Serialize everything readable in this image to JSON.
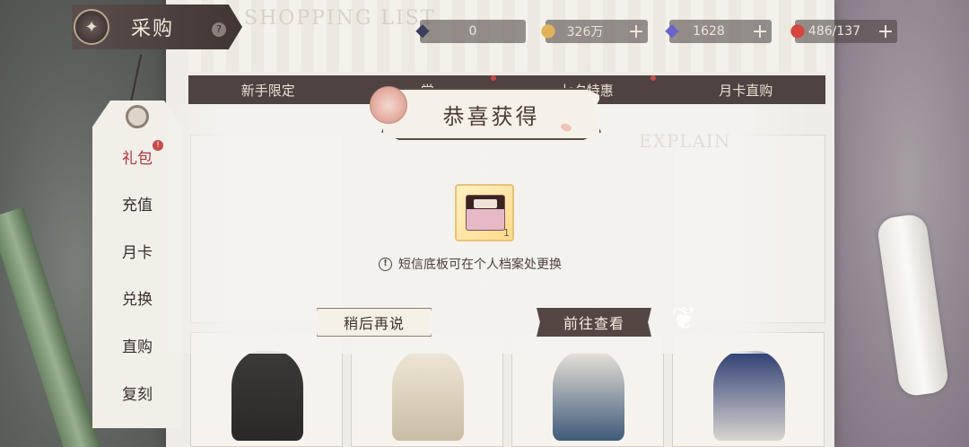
{
  "header": {
    "title": "采购",
    "ghost_title": "SHOPPING LIST"
  },
  "currencies": [
    {
      "name": "ticket",
      "value": "0"
    },
    {
      "name": "coins",
      "value": "326万"
    },
    {
      "name": "diamonds",
      "value": "1628"
    },
    {
      "name": "stamina",
      "value": "486/137"
    }
  ],
  "tabs": [
    "新手限定",
    "常",
    "七夕特惠",
    "月卡直购"
  ],
  "sidebar": {
    "items": [
      {
        "label": "礼包",
        "active": true
      },
      {
        "label": "充值"
      },
      {
        "label": "月卡"
      },
      {
        "label": "兑换"
      },
      {
        "label": "直购"
      },
      {
        "label": "复刻"
      }
    ],
    "badge": "!"
  },
  "modal": {
    "title": "恭喜获得",
    "ghost_text": "EXPLAIN",
    "reward_count": "1",
    "notice": "短信底板可在个人档案处更换",
    "btn_later": "稍后再说",
    "btn_go": "前往查看"
  },
  "colors": {
    "accent_dark": "#544642",
    "badge_red": "#c84a4a",
    "reward_gold": "#ffd98a"
  }
}
